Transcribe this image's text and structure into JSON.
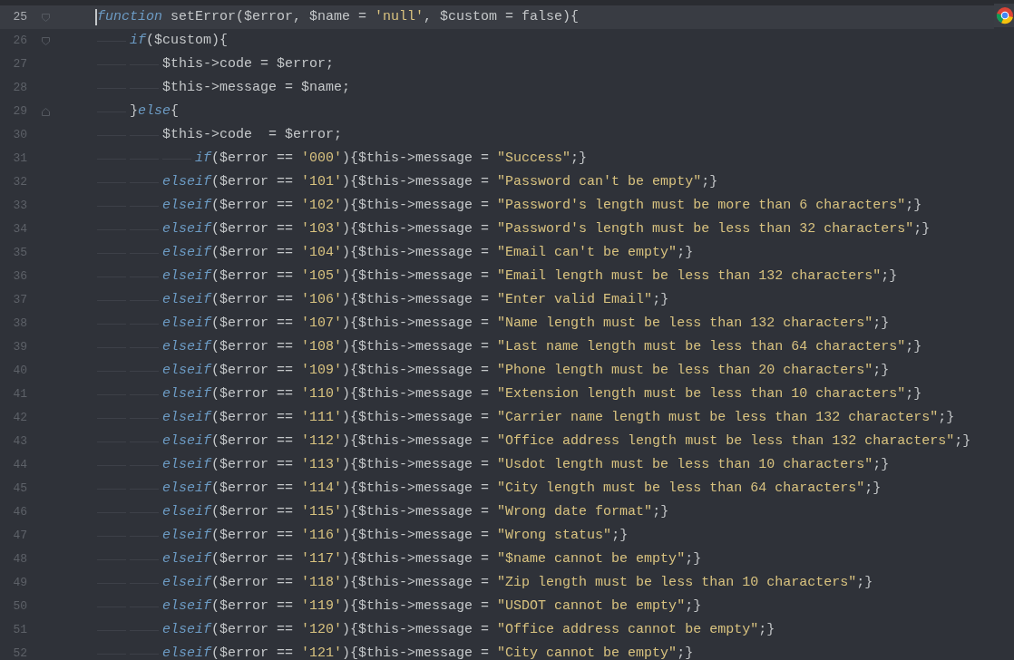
{
  "editor": {
    "lines": [
      {
        "number": "25",
        "current": true,
        "kind": "foldstart",
        "tokens": [
          {
            "kind": "keyword",
            "text": "function"
          },
          {
            "kind": "plain",
            "text": " setError($error, $name = "
          },
          {
            "kind": "string",
            "text": "'null'"
          },
          {
            "kind": "plain",
            "text": ", $custom = false){"
          }
        ],
        "children": [
          {
            "number": "26",
            "current": false,
            "kind": "foldstart",
            "tokens": [
              {
                "kind": "keyword",
                "text": "if"
              },
              {
                "kind": "plain",
                "text": "($custom){"
              }
            ],
            "children": [
              {
                "number": "27",
                "current": false,
                "tokens": [
                  {
                    "kind": "plain",
                    "text": "$this->code = $error;"
                  }
                ]
              },
              {
                "number": "28",
                "current": false,
                "tokens": [
                  {
                    "kind": "plain",
                    "text": "$this->message = $name;"
                  }
                ]
              }
            ]
          },
          {
            "number": "29",
            "current": false,
            "kind": "foldend",
            "tokens": [
              {
                "kind": "plain",
                "text": "}"
              },
              {
                "kind": "keyword",
                "text": "else"
              },
              {
                "kind": "plain",
                "text": "{"
              }
            ],
            "children": [
              {
                "number": "30",
                "current": false,
                "tokens": [
                  {
                    "kind": "plain",
                    "text": "$this->code  = $error;"
                  }
                ],
                "children": [
                  {
                    "number": "31",
                    "current": false,
                    "tokens": [
                      {
                        "kind": "keyword",
                        "text": "if"
                      },
                      {
                        "kind": "plain",
                        "text": "($error == "
                      },
                      {
                        "kind": "string",
                        "text": "'000'"
                      },
                      {
                        "kind": "plain",
                        "text": "){$this->message = "
                      },
                      {
                        "kind": "string",
                        "text": "\"Success\""
                      },
                      {
                        "kind": "plain",
                        "text": ";}"
                      }
                    ]
                  }
                ]
              },
              {
                "number": "32",
                "current": false,
                "tokens": [
                  {
                    "kind": "keyword",
                    "text": "elseif"
                  },
                  {
                    "kind": "plain",
                    "text": "($error == "
                  },
                  {
                    "kind": "string",
                    "text": "'101'"
                  },
                  {
                    "kind": "plain",
                    "text": "){$this->message = "
                  },
                  {
                    "kind": "string",
                    "text": "\"Password can't be empty\""
                  },
                  {
                    "kind": "plain",
                    "text": ";}"
                  }
                ]
              },
              {
                "number": "33",
                "current": false,
                "tokens": [
                  {
                    "kind": "keyword",
                    "text": "elseif"
                  },
                  {
                    "kind": "plain",
                    "text": "($error == "
                  },
                  {
                    "kind": "string",
                    "text": "'102'"
                  },
                  {
                    "kind": "plain",
                    "text": "){$this->message = "
                  },
                  {
                    "kind": "string",
                    "text": "\"Password's length must be more than 6 characters\""
                  },
                  {
                    "kind": "plain",
                    "text": ";}"
                  }
                ]
              },
              {
                "number": "34",
                "current": false,
                "tokens": [
                  {
                    "kind": "keyword",
                    "text": "elseif"
                  },
                  {
                    "kind": "plain",
                    "text": "($error == "
                  },
                  {
                    "kind": "string",
                    "text": "'103'"
                  },
                  {
                    "kind": "plain",
                    "text": "){$this->message = "
                  },
                  {
                    "kind": "string",
                    "text": "\"Password's length must be less than 32 characters\""
                  },
                  {
                    "kind": "plain",
                    "text": ";}"
                  }
                ]
              },
              {
                "number": "35",
                "current": false,
                "tokens": [
                  {
                    "kind": "keyword",
                    "text": "elseif"
                  },
                  {
                    "kind": "plain",
                    "text": "($error == "
                  },
                  {
                    "kind": "string",
                    "text": "'104'"
                  },
                  {
                    "kind": "plain",
                    "text": "){$this->message = "
                  },
                  {
                    "kind": "string",
                    "text": "\"Email can't be empty\""
                  },
                  {
                    "kind": "plain",
                    "text": ";}"
                  }
                ]
              },
              {
                "number": "36",
                "current": false,
                "tokens": [
                  {
                    "kind": "keyword",
                    "text": "elseif"
                  },
                  {
                    "kind": "plain",
                    "text": "($error == "
                  },
                  {
                    "kind": "string",
                    "text": "'105'"
                  },
                  {
                    "kind": "plain",
                    "text": "){$this->message = "
                  },
                  {
                    "kind": "string",
                    "text": "\"Email length must be less than 132 characters\""
                  },
                  {
                    "kind": "plain",
                    "text": ";}"
                  }
                ]
              },
              {
                "number": "37",
                "current": false,
                "tokens": [
                  {
                    "kind": "keyword",
                    "text": "elseif"
                  },
                  {
                    "kind": "plain",
                    "text": "($error == "
                  },
                  {
                    "kind": "string",
                    "text": "'106'"
                  },
                  {
                    "kind": "plain",
                    "text": "){$this->message = "
                  },
                  {
                    "kind": "string",
                    "text": "\"Enter valid Email\""
                  },
                  {
                    "kind": "plain",
                    "text": ";}"
                  }
                ]
              },
              {
                "number": "38",
                "current": false,
                "tokens": [
                  {
                    "kind": "keyword",
                    "text": "elseif"
                  },
                  {
                    "kind": "plain",
                    "text": "($error == "
                  },
                  {
                    "kind": "string",
                    "text": "'107'"
                  },
                  {
                    "kind": "plain",
                    "text": "){$this->message = "
                  },
                  {
                    "kind": "string",
                    "text": "\"Name length must be less than 132 characters\""
                  },
                  {
                    "kind": "plain",
                    "text": ";}"
                  }
                ]
              },
              {
                "number": "39",
                "current": false,
                "tokens": [
                  {
                    "kind": "keyword",
                    "text": "elseif"
                  },
                  {
                    "kind": "plain",
                    "text": "($error == "
                  },
                  {
                    "kind": "string",
                    "text": "'108'"
                  },
                  {
                    "kind": "plain",
                    "text": "){$this->message = "
                  },
                  {
                    "kind": "string",
                    "text": "\"Last name length must be less than 64 characters\""
                  },
                  {
                    "kind": "plain",
                    "text": ";}"
                  }
                ]
              },
              {
                "number": "40",
                "current": false,
                "tokens": [
                  {
                    "kind": "keyword",
                    "text": "elseif"
                  },
                  {
                    "kind": "plain",
                    "text": "($error == "
                  },
                  {
                    "kind": "string",
                    "text": "'109'"
                  },
                  {
                    "kind": "plain",
                    "text": "){$this->message = "
                  },
                  {
                    "kind": "string",
                    "text": "\"Phone length must be less than 20 characters\""
                  },
                  {
                    "kind": "plain",
                    "text": ";}"
                  }
                ]
              },
              {
                "number": "41",
                "current": false,
                "tokens": [
                  {
                    "kind": "keyword",
                    "text": "elseif"
                  },
                  {
                    "kind": "plain",
                    "text": "($error == "
                  },
                  {
                    "kind": "string",
                    "text": "'110'"
                  },
                  {
                    "kind": "plain",
                    "text": "){$this->message = "
                  },
                  {
                    "kind": "string",
                    "text": "\"Extension length must be less than 10 characters\""
                  },
                  {
                    "kind": "plain",
                    "text": ";}"
                  }
                ]
              },
              {
                "number": "42",
                "current": false,
                "tokens": [
                  {
                    "kind": "keyword",
                    "text": "elseif"
                  },
                  {
                    "kind": "plain",
                    "text": "($error == "
                  },
                  {
                    "kind": "string",
                    "text": "'111'"
                  },
                  {
                    "kind": "plain",
                    "text": "){$this->message = "
                  },
                  {
                    "kind": "string",
                    "text": "\"Carrier name length must be less than 132 characters\""
                  },
                  {
                    "kind": "plain",
                    "text": ";}"
                  }
                ]
              },
              {
                "number": "43",
                "current": false,
                "tokens": [
                  {
                    "kind": "keyword",
                    "text": "elseif"
                  },
                  {
                    "kind": "plain",
                    "text": "($error == "
                  },
                  {
                    "kind": "string",
                    "text": "'112'"
                  },
                  {
                    "kind": "plain",
                    "text": "){$this->message = "
                  },
                  {
                    "kind": "string",
                    "text": "\"Office address length must be less than 132 characters\""
                  },
                  {
                    "kind": "plain",
                    "text": ";}"
                  }
                ]
              },
              {
                "number": "44",
                "current": false,
                "tokens": [
                  {
                    "kind": "keyword",
                    "text": "elseif"
                  },
                  {
                    "kind": "plain",
                    "text": "($error == "
                  },
                  {
                    "kind": "string",
                    "text": "'113'"
                  },
                  {
                    "kind": "plain",
                    "text": "){$this->message = "
                  },
                  {
                    "kind": "string",
                    "text": "\"Usdot length must be less than 10 characters\""
                  },
                  {
                    "kind": "plain",
                    "text": ";}"
                  }
                ]
              },
              {
                "number": "45",
                "current": false,
                "tokens": [
                  {
                    "kind": "keyword",
                    "text": "elseif"
                  },
                  {
                    "kind": "plain",
                    "text": "($error == "
                  },
                  {
                    "kind": "string",
                    "text": "'114'"
                  },
                  {
                    "kind": "plain",
                    "text": "){$this->message = "
                  },
                  {
                    "kind": "string",
                    "text": "\"City length must be less than 64 characters\""
                  },
                  {
                    "kind": "plain",
                    "text": ";}"
                  }
                ]
              },
              {
                "number": "46",
                "current": false,
                "tokens": [
                  {
                    "kind": "keyword",
                    "text": "elseif"
                  },
                  {
                    "kind": "plain",
                    "text": "($error == "
                  },
                  {
                    "kind": "string",
                    "text": "'115'"
                  },
                  {
                    "kind": "plain",
                    "text": "){$this->message = "
                  },
                  {
                    "kind": "string",
                    "text": "\"Wrong date format\""
                  },
                  {
                    "kind": "plain",
                    "text": ";}"
                  }
                ]
              },
              {
                "number": "47",
                "current": false,
                "tokens": [
                  {
                    "kind": "keyword",
                    "text": "elseif"
                  },
                  {
                    "kind": "plain",
                    "text": "($error == "
                  },
                  {
                    "kind": "string",
                    "text": "'116'"
                  },
                  {
                    "kind": "plain",
                    "text": "){$this->message = "
                  },
                  {
                    "kind": "string",
                    "text": "\"Wrong status\""
                  },
                  {
                    "kind": "plain",
                    "text": ";}"
                  }
                ]
              },
              {
                "number": "48",
                "current": false,
                "tokens": [
                  {
                    "kind": "keyword",
                    "text": "elseif"
                  },
                  {
                    "kind": "plain",
                    "text": "($error == "
                  },
                  {
                    "kind": "string",
                    "text": "'117'"
                  },
                  {
                    "kind": "plain",
                    "text": "){$this->message = "
                  },
                  {
                    "kind": "string",
                    "text": "\"$name cannot be empty\""
                  },
                  {
                    "kind": "plain",
                    "text": ";}"
                  }
                ]
              },
              {
                "number": "49",
                "current": false,
                "tokens": [
                  {
                    "kind": "keyword",
                    "text": "elseif"
                  },
                  {
                    "kind": "plain",
                    "text": "($error == "
                  },
                  {
                    "kind": "string",
                    "text": "'118'"
                  },
                  {
                    "kind": "plain",
                    "text": "){$this->message = "
                  },
                  {
                    "kind": "string",
                    "text": "\"Zip length must be less than 10 characters\""
                  },
                  {
                    "kind": "plain",
                    "text": ";}"
                  }
                ]
              },
              {
                "number": "50",
                "current": false,
                "tokens": [
                  {
                    "kind": "keyword",
                    "text": "elseif"
                  },
                  {
                    "kind": "plain",
                    "text": "($error == "
                  },
                  {
                    "kind": "string",
                    "text": "'119'"
                  },
                  {
                    "kind": "plain",
                    "text": "){$this->message = "
                  },
                  {
                    "kind": "string",
                    "text": "\"USDOT cannot be empty\""
                  },
                  {
                    "kind": "plain",
                    "text": ";}"
                  }
                ]
              },
              {
                "number": "51",
                "current": false,
                "tokens": [
                  {
                    "kind": "keyword",
                    "text": "elseif"
                  },
                  {
                    "kind": "plain",
                    "text": "($error == "
                  },
                  {
                    "kind": "string",
                    "text": "'120'"
                  },
                  {
                    "kind": "plain",
                    "text": "){$this->message = "
                  },
                  {
                    "kind": "string",
                    "text": "\"Office address cannot be empty\""
                  },
                  {
                    "kind": "plain",
                    "text": ";}"
                  }
                ]
              },
              {
                "number": "52",
                "current": false,
                "tokens": [
                  {
                    "kind": "keyword",
                    "text": "elseif"
                  },
                  {
                    "kind": "plain",
                    "text": "($error == "
                  },
                  {
                    "kind": "string",
                    "text": "'121'"
                  },
                  {
                    "kind": "plain",
                    "text": "){$this->message = "
                  },
                  {
                    "kind": "string",
                    "text": "\"City cannot be empty\""
                  },
                  {
                    "kind": "plain",
                    "text": ";}"
                  }
                ]
              }
            ]
          }
        ]
      }
    ]
  }
}
